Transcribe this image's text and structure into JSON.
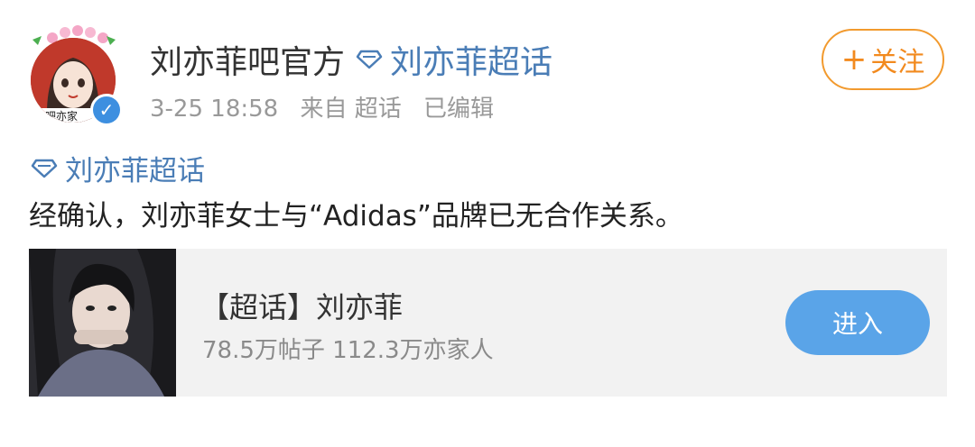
{
  "post": {
    "author": {
      "name": "刘亦菲吧官方",
      "topic": "刘亦菲超话",
      "avatar_text": "菲吧亦家"
    },
    "meta": {
      "time": "3-25 18:58",
      "source": "来自 超话",
      "edited": "已编辑"
    },
    "follow_label": "关注",
    "follow_plus": "+",
    "body_topic": "刘亦菲超话",
    "body_text": "经确认，刘亦菲女士与“Adidas”品牌已无合作关系。",
    "card": {
      "title": "【超话】刘亦菲",
      "subtitle": "78.5万帖子 112.3万亦家人",
      "button": "进入"
    }
  },
  "colors": {
    "link_blue": "#4a7db6",
    "follow_orange": "#f28a1e",
    "enter_blue": "#5aa4e8",
    "verified_blue": "#3d8fe0"
  },
  "icons": {
    "verified": "verified-badge-icon",
    "topic": "diamond-icon",
    "plus": "plus-icon"
  }
}
